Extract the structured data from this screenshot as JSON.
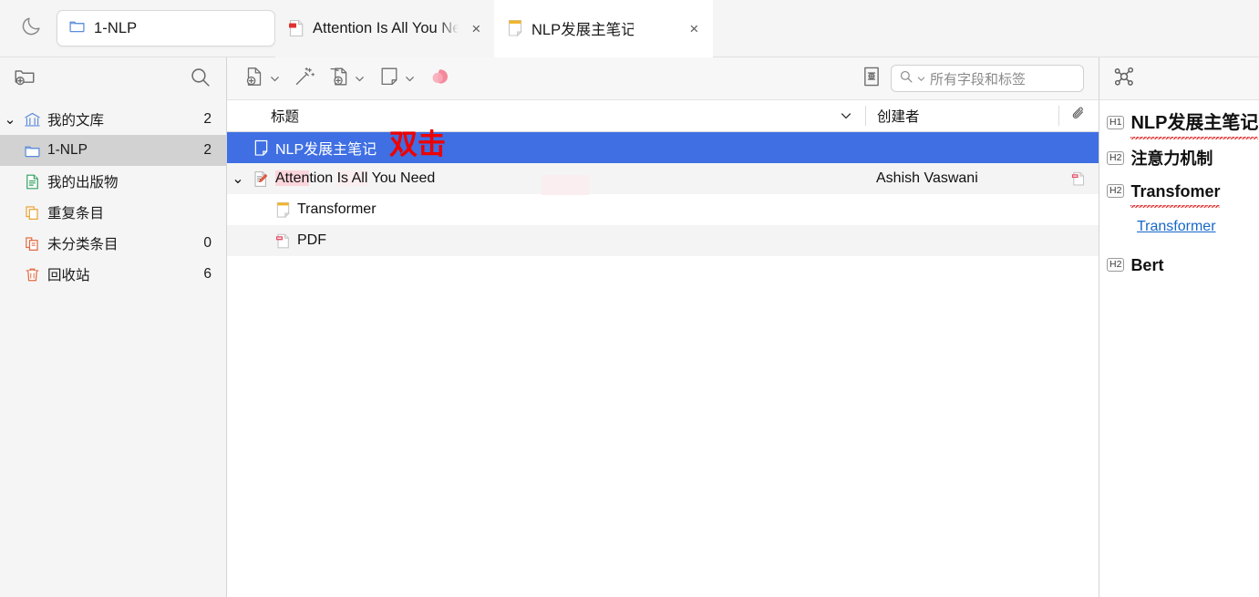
{
  "window": {
    "theme_toggle_icon": "moon-icon"
  },
  "tabs": {
    "library_tab": {
      "label": "1-NLP",
      "icon": "folder-icon"
    },
    "items": [
      {
        "label": "Attention Is All You Need",
        "icon": "pdf-document-icon",
        "active": false,
        "close_label": "×"
      },
      {
        "label": "NLP发展主笔记",
        "icon": "note-icon",
        "active": true,
        "close_label": "×"
      }
    ]
  },
  "sidebar": {
    "toolbar": {
      "new_collection_icon": "new-collection-icon",
      "search_icon": "search-icon"
    },
    "items": [
      {
        "label": "我的文库",
        "count": "2",
        "icon": "library-icon",
        "indent": 0,
        "twisty": "⌄",
        "selected": false
      },
      {
        "label": "1-NLP",
        "count": "2",
        "icon": "folder-icon",
        "indent": 1,
        "twisty": "",
        "selected": true
      },
      {
        "label": "我的出版物",
        "count": "",
        "icon": "publications-icon",
        "indent": 1,
        "twisty": "",
        "selected": false
      },
      {
        "label": "重复条目",
        "count": "",
        "icon": "duplicates-icon",
        "indent": 1,
        "twisty": "",
        "selected": false
      },
      {
        "label": "未分类条目",
        "count": "0",
        "icon": "unfiled-icon",
        "indent": 1,
        "twisty": "",
        "selected": false
      },
      {
        "label": "回收站",
        "count": "6",
        "icon": "trash-icon",
        "indent": 1,
        "twisty": "",
        "selected": false
      }
    ]
  },
  "item_toolbar": {
    "buttons": [
      {
        "name": "new-item-button",
        "icon": "new-item-icon",
        "has_chevron": true
      },
      {
        "name": "add-by-identifier-button",
        "icon": "magic-wand-icon",
        "has_chevron": false
      },
      {
        "name": "add-attachment-button",
        "icon": "add-attachment-icon",
        "has_chevron": true
      },
      {
        "name": "new-note-button",
        "icon": "new-note-icon",
        "has_chevron": true
      },
      {
        "name": "plugin-button",
        "icon": "pink-blob-icon",
        "has_chevron": false
      }
    ],
    "advanced_search_icon": "advanced-search-icon",
    "search": {
      "placeholder": "所有字段和标签",
      "value": "",
      "icon": "search-icon",
      "chevron": "⌄"
    }
  },
  "columns": {
    "title": "标题",
    "creator": "创建者",
    "attachment_icon": "paperclip-icon",
    "sort_chevron": "⌄"
  },
  "rows": [
    {
      "title": "NLP发展主笔记",
      "creator": "",
      "icon": "note-icon",
      "indent": 0,
      "twisty": "",
      "selected": true,
      "alt": false,
      "attachment": "",
      "annotation": "双击"
    },
    {
      "title": "Attention Is All You Need",
      "creator": "Ashish Vaswani",
      "icon": "preprint-icon",
      "indent": 0,
      "twisty": "⌄",
      "selected": false,
      "alt": true,
      "attachment": "pdf-icon",
      "annotation": ""
    },
    {
      "title": "Transformer",
      "creator": "",
      "icon": "note-icon",
      "indent": 1,
      "twisty": "",
      "selected": false,
      "alt": false,
      "attachment": "",
      "annotation": ""
    },
    {
      "title": "PDF",
      "creator": "",
      "icon": "pdf-icon",
      "indent": 1,
      "twisty": "",
      "selected": false,
      "alt": true,
      "attachment": "",
      "annotation": ""
    }
  ],
  "right_pane": {
    "toolbar_icon": "related-graph-icon",
    "outline": [
      {
        "tag": "H1",
        "text": "NLP发展主笔记",
        "level": "h1",
        "spell_error": true,
        "kind": "heading"
      },
      {
        "tag": "H2",
        "text": "注意力机制",
        "level": "h2",
        "spell_error": false,
        "kind": "heading"
      },
      {
        "tag": "H2",
        "text": "Transfomer",
        "level": "h2",
        "spell_error": true,
        "kind": "heading"
      },
      {
        "tag": "",
        "text": "Transformer",
        "level": "",
        "spell_error": false,
        "kind": "link"
      },
      {
        "tag": "H2",
        "text": "Bert",
        "level": "h2",
        "spell_error": false,
        "kind": "heading"
      }
    ]
  },
  "colors": {
    "selection_blue": "#3f6fe3",
    "annotation_red": "#ef0000",
    "link_blue": "#1667c9",
    "sidebar_bg": "#f5f5f5",
    "highlight_pink": "#fbd5dc"
  }
}
